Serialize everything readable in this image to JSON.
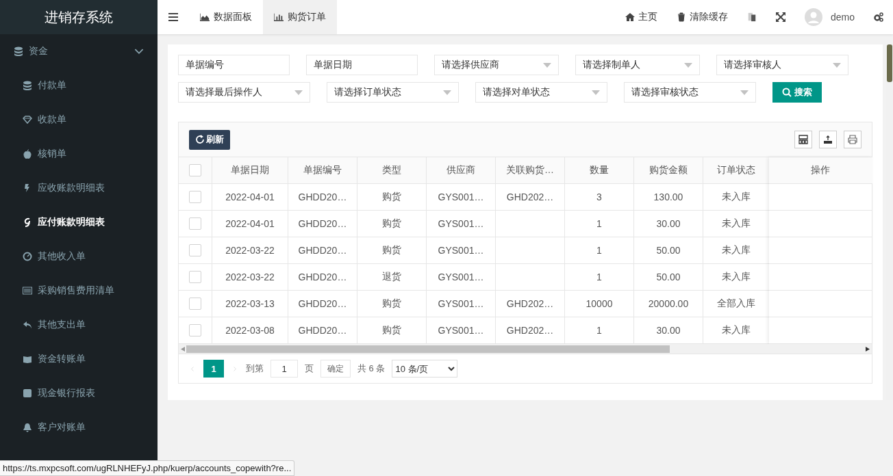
{
  "sidebar": {
    "title": "进销存系统",
    "group": {
      "label": "资金",
      "expanded": true
    },
    "items": [
      {
        "label": "付款单",
        "selected": false
      },
      {
        "label": "收款单",
        "selected": false
      },
      {
        "label": "核销单",
        "selected": false
      },
      {
        "label": "应收账款明细表",
        "selected": false
      },
      {
        "label": "应付账款明细表",
        "selected": true
      },
      {
        "label": "其他收入单",
        "selected": false
      },
      {
        "label": "采购销售费用清单",
        "selected": false
      },
      {
        "label": "其他支出单",
        "selected": false
      },
      {
        "label": "资金转账单",
        "selected": false
      },
      {
        "label": "现金银行报表",
        "selected": false
      },
      {
        "label": "客户对账单",
        "selected": false
      }
    ]
  },
  "topbar": {
    "tabs": [
      {
        "label": "数据面板",
        "selected": false
      },
      {
        "label": "购货订单",
        "selected": true
      }
    ],
    "actions": [
      {
        "label": "主页"
      },
      {
        "label": "清除缓存"
      }
    ],
    "user": "demo"
  },
  "filters": [
    {
      "kind": "input",
      "placeholder": "单据编号"
    },
    {
      "kind": "input",
      "placeholder": "单据日期"
    },
    {
      "kind": "select",
      "placeholder": "请选择供应商"
    },
    {
      "kind": "select",
      "placeholder": "请选择制单人"
    },
    {
      "kind": "select",
      "placeholder": "请选择审核人"
    },
    {
      "kind": "select",
      "placeholder": "请选择最后操作人"
    },
    {
      "kind": "select",
      "placeholder": "请选择订单状态"
    },
    {
      "kind": "select",
      "placeholder": "请选择对单状态"
    },
    {
      "kind": "select",
      "placeholder": "请选择审核状态"
    }
  ],
  "search_button": "搜索",
  "refresh_button": "刷新",
  "table": {
    "columns": [
      "单据日期",
      "单据编号",
      "类型",
      "供应商",
      "关联购货…",
      "数量",
      "购货金额",
      "订单状态",
      "操作"
    ],
    "header_checked": false,
    "rows": [
      {
        "checked": false,
        "cells": [
          "2022-04-01",
          "GHDD20…",
          "购货",
          "GYS001…",
          "GHD202…",
          "3",
          "130.00",
          "未入库"
        ]
      },
      {
        "checked": false,
        "cells": [
          "2022-04-01",
          "GHDD20…",
          "购货",
          "GYS001…",
          "",
          "1",
          "30.00",
          "未入库"
        ]
      },
      {
        "checked": false,
        "cells": [
          "2022-03-22",
          "GHDD20…",
          "购货",
          "GYS001…",
          "",
          "1",
          "50.00",
          "未入库"
        ]
      },
      {
        "checked": false,
        "cells": [
          "2022-03-22",
          "GHDD20…",
          "退货",
          "GYS001…",
          "",
          "1",
          "50.00",
          "未入库"
        ]
      },
      {
        "checked": false,
        "cells": [
          "2022-03-13",
          "GHDD20…",
          "购货",
          "GYS001…",
          "GHD202…",
          "10000",
          "20000.00",
          "全部入库"
        ]
      },
      {
        "checked": false,
        "cells": [
          "2022-03-08",
          "GHDD20…",
          "购货",
          "GYS001…",
          "GHD202…",
          "1",
          "30.00",
          "未入库"
        ]
      }
    ]
  },
  "pagination": {
    "pages": [
      {
        "label": "1",
        "selected": true
      }
    ],
    "goto_label": "到第",
    "page_input": "1",
    "page_unit": "页",
    "confirm": "确定",
    "total": "共 6 条",
    "page_size": "10 条/页"
  },
  "status_url": "https://ts.mxpcsoft.com/ugRLNHEFyJ.php/kuerp/accounts_copewith?re..."
}
